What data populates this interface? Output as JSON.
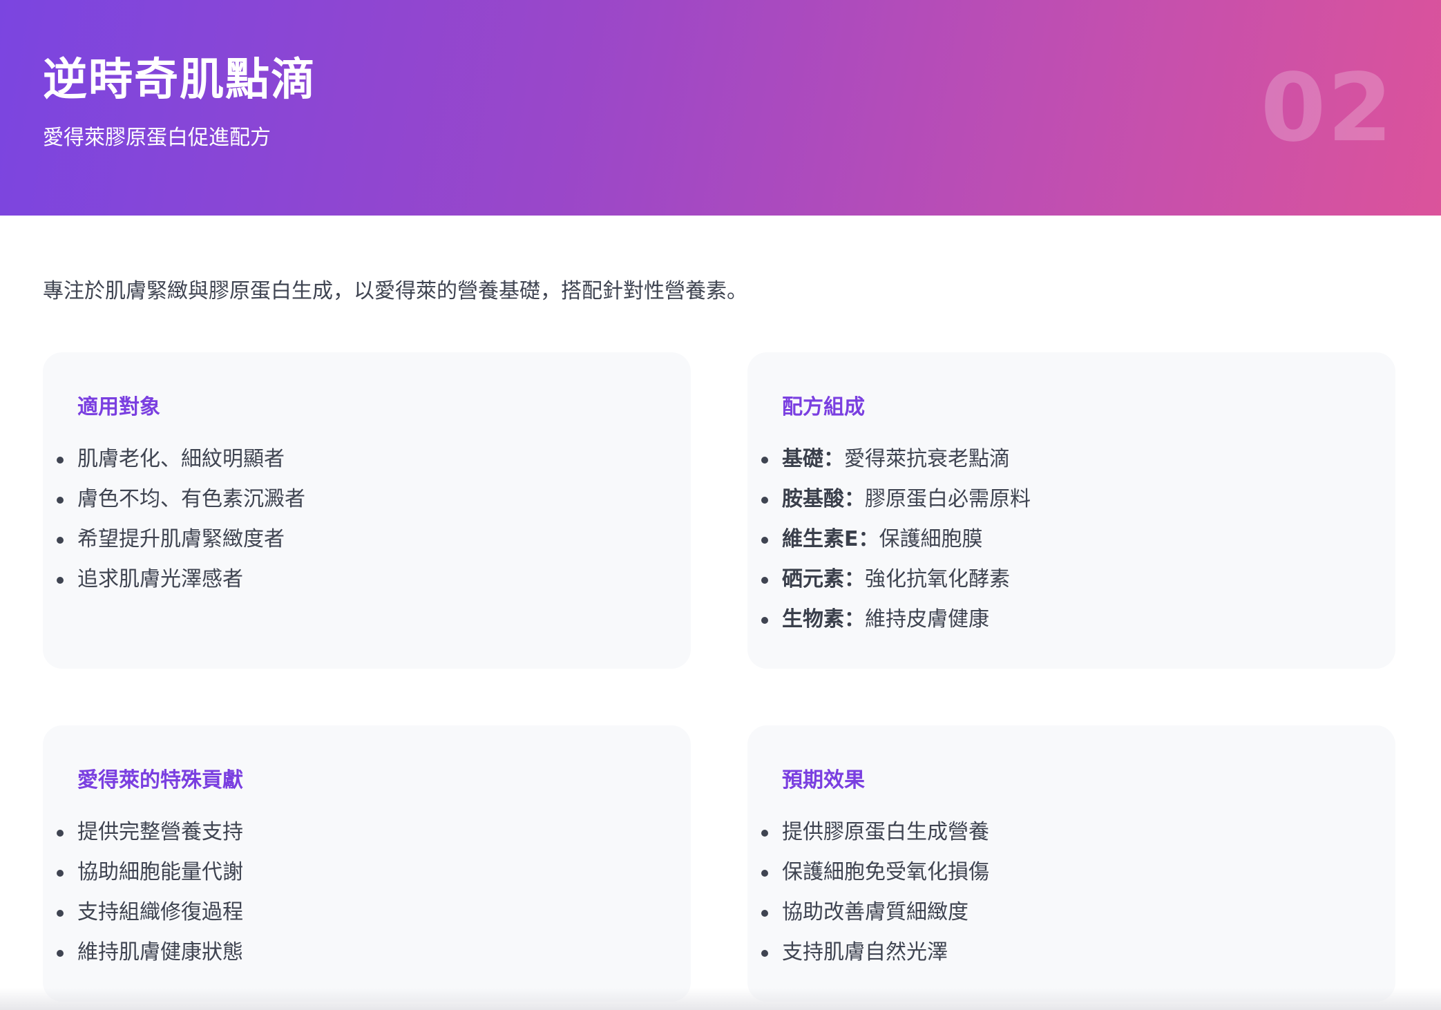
{
  "header": {
    "title": "逆時奇肌點滴",
    "subtitle": "愛得萊膠原蛋白促進配方",
    "page_number": "02"
  },
  "intro": "專注於肌膚緊緻與膠原蛋白生成，以愛得萊的營養基礎，搭配針對性營養素。",
  "cards": [
    {
      "title": "適用對象",
      "items": [
        "肌膚老化、細紋明顯者",
        "膚色不均、有色素沉澱者",
        "希望提升肌膚緊緻度者",
        "追求肌膚光澤感者"
      ]
    },
    {
      "title": "配方組成",
      "items": [
        {
          "key": "基礎：",
          "value": "愛得萊抗衰老點滴"
        },
        {
          "key": "胺基酸：",
          "value": "膠原蛋白必需原料"
        },
        {
          "key": "維生素E：",
          "value": "保護細胞膜"
        },
        {
          "key": "硒元素：",
          "value": "強化抗氧化酵素"
        },
        {
          "key": "生物素：",
          "value": "維持皮膚健康"
        }
      ]
    },
    {
      "title": "愛得萊的特殊貢獻",
      "items": [
        "提供完整營養支持",
        "協助細胞能量代謝",
        "支持組織修復過程",
        "維持肌膚健康狀態"
      ]
    },
    {
      "title": "預期效果",
      "items": [
        "提供膠原蛋白生成營養",
        "保護細胞免受氧化損傷",
        "協助改善膚質細緻度",
        "支持肌膚自然光澤"
      ]
    }
  ]
}
